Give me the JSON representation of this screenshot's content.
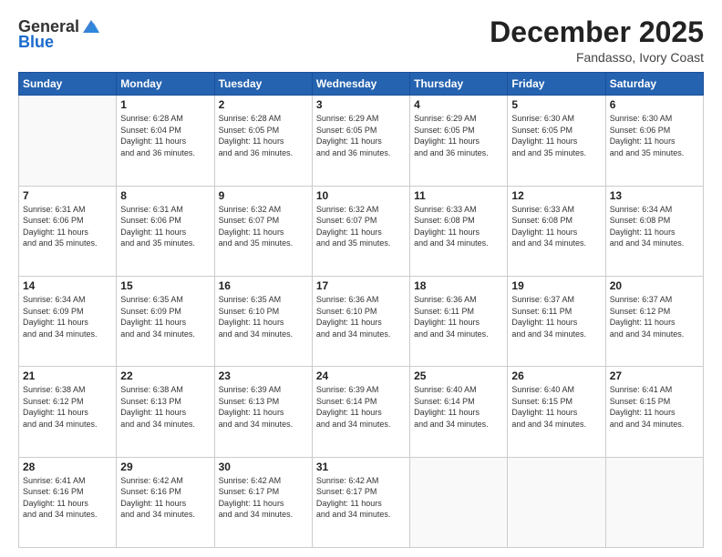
{
  "header": {
    "logo_line1": "General",
    "logo_line2": "Blue",
    "month": "December 2025",
    "location": "Fandasso, Ivory Coast"
  },
  "weekdays": [
    "Sunday",
    "Monday",
    "Tuesday",
    "Wednesday",
    "Thursday",
    "Friday",
    "Saturday"
  ],
  "weeks": [
    [
      {
        "day": "",
        "sunrise": "",
        "sunset": "",
        "daylight": ""
      },
      {
        "day": "1",
        "sunrise": "Sunrise: 6:28 AM",
        "sunset": "Sunset: 6:04 PM",
        "daylight": "Daylight: 11 hours and 36 minutes."
      },
      {
        "day": "2",
        "sunrise": "Sunrise: 6:28 AM",
        "sunset": "Sunset: 6:05 PM",
        "daylight": "Daylight: 11 hours and 36 minutes."
      },
      {
        "day": "3",
        "sunrise": "Sunrise: 6:29 AM",
        "sunset": "Sunset: 6:05 PM",
        "daylight": "Daylight: 11 hours and 36 minutes."
      },
      {
        "day": "4",
        "sunrise": "Sunrise: 6:29 AM",
        "sunset": "Sunset: 6:05 PM",
        "daylight": "Daylight: 11 hours and 36 minutes."
      },
      {
        "day": "5",
        "sunrise": "Sunrise: 6:30 AM",
        "sunset": "Sunset: 6:05 PM",
        "daylight": "Daylight: 11 hours and 35 minutes."
      },
      {
        "day": "6",
        "sunrise": "Sunrise: 6:30 AM",
        "sunset": "Sunset: 6:06 PM",
        "daylight": "Daylight: 11 hours and 35 minutes."
      }
    ],
    [
      {
        "day": "7",
        "sunrise": "Sunrise: 6:31 AM",
        "sunset": "Sunset: 6:06 PM",
        "daylight": "Daylight: 11 hours and 35 minutes."
      },
      {
        "day": "8",
        "sunrise": "Sunrise: 6:31 AM",
        "sunset": "Sunset: 6:06 PM",
        "daylight": "Daylight: 11 hours and 35 minutes."
      },
      {
        "day": "9",
        "sunrise": "Sunrise: 6:32 AM",
        "sunset": "Sunset: 6:07 PM",
        "daylight": "Daylight: 11 hours and 35 minutes."
      },
      {
        "day": "10",
        "sunrise": "Sunrise: 6:32 AM",
        "sunset": "Sunset: 6:07 PM",
        "daylight": "Daylight: 11 hours and 35 minutes."
      },
      {
        "day": "11",
        "sunrise": "Sunrise: 6:33 AM",
        "sunset": "Sunset: 6:08 PM",
        "daylight": "Daylight: 11 hours and 34 minutes."
      },
      {
        "day": "12",
        "sunrise": "Sunrise: 6:33 AM",
        "sunset": "Sunset: 6:08 PM",
        "daylight": "Daylight: 11 hours and 34 minutes."
      },
      {
        "day": "13",
        "sunrise": "Sunrise: 6:34 AM",
        "sunset": "Sunset: 6:08 PM",
        "daylight": "Daylight: 11 hours and 34 minutes."
      }
    ],
    [
      {
        "day": "14",
        "sunrise": "Sunrise: 6:34 AM",
        "sunset": "Sunset: 6:09 PM",
        "daylight": "Daylight: 11 hours and 34 minutes."
      },
      {
        "day": "15",
        "sunrise": "Sunrise: 6:35 AM",
        "sunset": "Sunset: 6:09 PM",
        "daylight": "Daylight: 11 hours and 34 minutes."
      },
      {
        "day": "16",
        "sunrise": "Sunrise: 6:35 AM",
        "sunset": "Sunset: 6:10 PM",
        "daylight": "Daylight: 11 hours and 34 minutes."
      },
      {
        "day": "17",
        "sunrise": "Sunrise: 6:36 AM",
        "sunset": "Sunset: 6:10 PM",
        "daylight": "Daylight: 11 hours and 34 minutes."
      },
      {
        "day": "18",
        "sunrise": "Sunrise: 6:36 AM",
        "sunset": "Sunset: 6:11 PM",
        "daylight": "Daylight: 11 hours and 34 minutes."
      },
      {
        "day": "19",
        "sunrise": "Sunrise: 6:37 AM",
        "sunset": "Sunset: 6:11 PM",
        "daylight": "Daylight: 11 hours and 34 minutes."
      },
      {
        "day": "20",
        "sunrise": "Sunrise: 6:37 AM",
        "sunset": "Sunset: 6:12 PM",
        "daylight": "Daylight: 11 hours and 34 minutes."
      }
    ],
    [
      {
        "day": "21",
        "sunrise": "Sunrise: 6:38 AM",
        "sunset": "Sunset: 6:12 PM",
        "daylight": "Daylight: 11 hours and 34 minutes."
      },
      {
        "day": "22",
        "sunrise": "Sunrise: 6:38 AM",
        "sunset": "Sunset: 6:13 PM",
        "daylight": "Daylight: 11 hours and 34 minutes."
      },
      {
        "day": "23",
        "sunrise": "Sunrise: 6:39 AM",
        "sunset": "Sunset: 6:13 PM",
        "daylight": "Daylight: 11 hours and 34 minutes."
      },
      {
        "day": "24",
        "sunrise": "Sunrise: 6:39 AM",
        "sunset": "Sunset: 6:14 PM",
        "daylight": "Daylight: 11 hours and 34 minutes."
      },
      {
        "day": "25",
        "sunrise": "Sunrise: 6:40 AM",
        "sunset": "Sunset: 6:14 PM",
        "daylight": "Daylight: 11 hours and 34 minutes."
      },
      {
        "day": "26",
        "sunrise": "Sunrise: 6:40 AM",
        "sunset": "Sunset: 6:15 PM",
        "daylight": "Daylight: 11 hours and 34 minutes."
      },
      {
        "day": "27",
        "sunrise": "Sunrise: 6:41 AM",
        "sunset": "Sunset: 6:15 PM",
        "daylight": "Daylight: 11 hours and 34 minutes."
      }
    ],
    [
      {
        "day": "28",
        "sunrise": "Sunrise: 6:41 AM",
        "sunset": "Sunset: 6:16 PM",
        "daylight": "Daylight: 11 hours and 34 minutes."
      },
      {
        "day": "29",
        "sunrise": "Sunrise: 6:42 AM",
        "sunset": "Sunset: 6:16 PM",
        "daylight": "Daylight: 11 hours and 34 minutes."
      },
      {
        "day": "30",
        "sunrise": "Sunrise: 6:42 AM",
        "sunset": "Sunset: 6:17 PM",
        "daylight": "Daylight: 11 hours and 34 minutes."
      },
      {
        "day": "31",
        "sunrise": "Sunrise: 6:42 AM",
        "sunset": "Sunset: 6:17 PM",
        "daylight": "Daylight: 11 hours and 34 minutes."
      },
      {
        "day": "",
        "sunrise": "",
        "sunset": "",
        "daylight": ""
      },
      {
        "day": "",
        "sunrise": "",
        "sunset": "",
        "daylight": ""
      },
      {
        "day": "",
        "sunrise": "",
        "sunset": "",
        "daylight": ""
      }
    ]
  ]
}
